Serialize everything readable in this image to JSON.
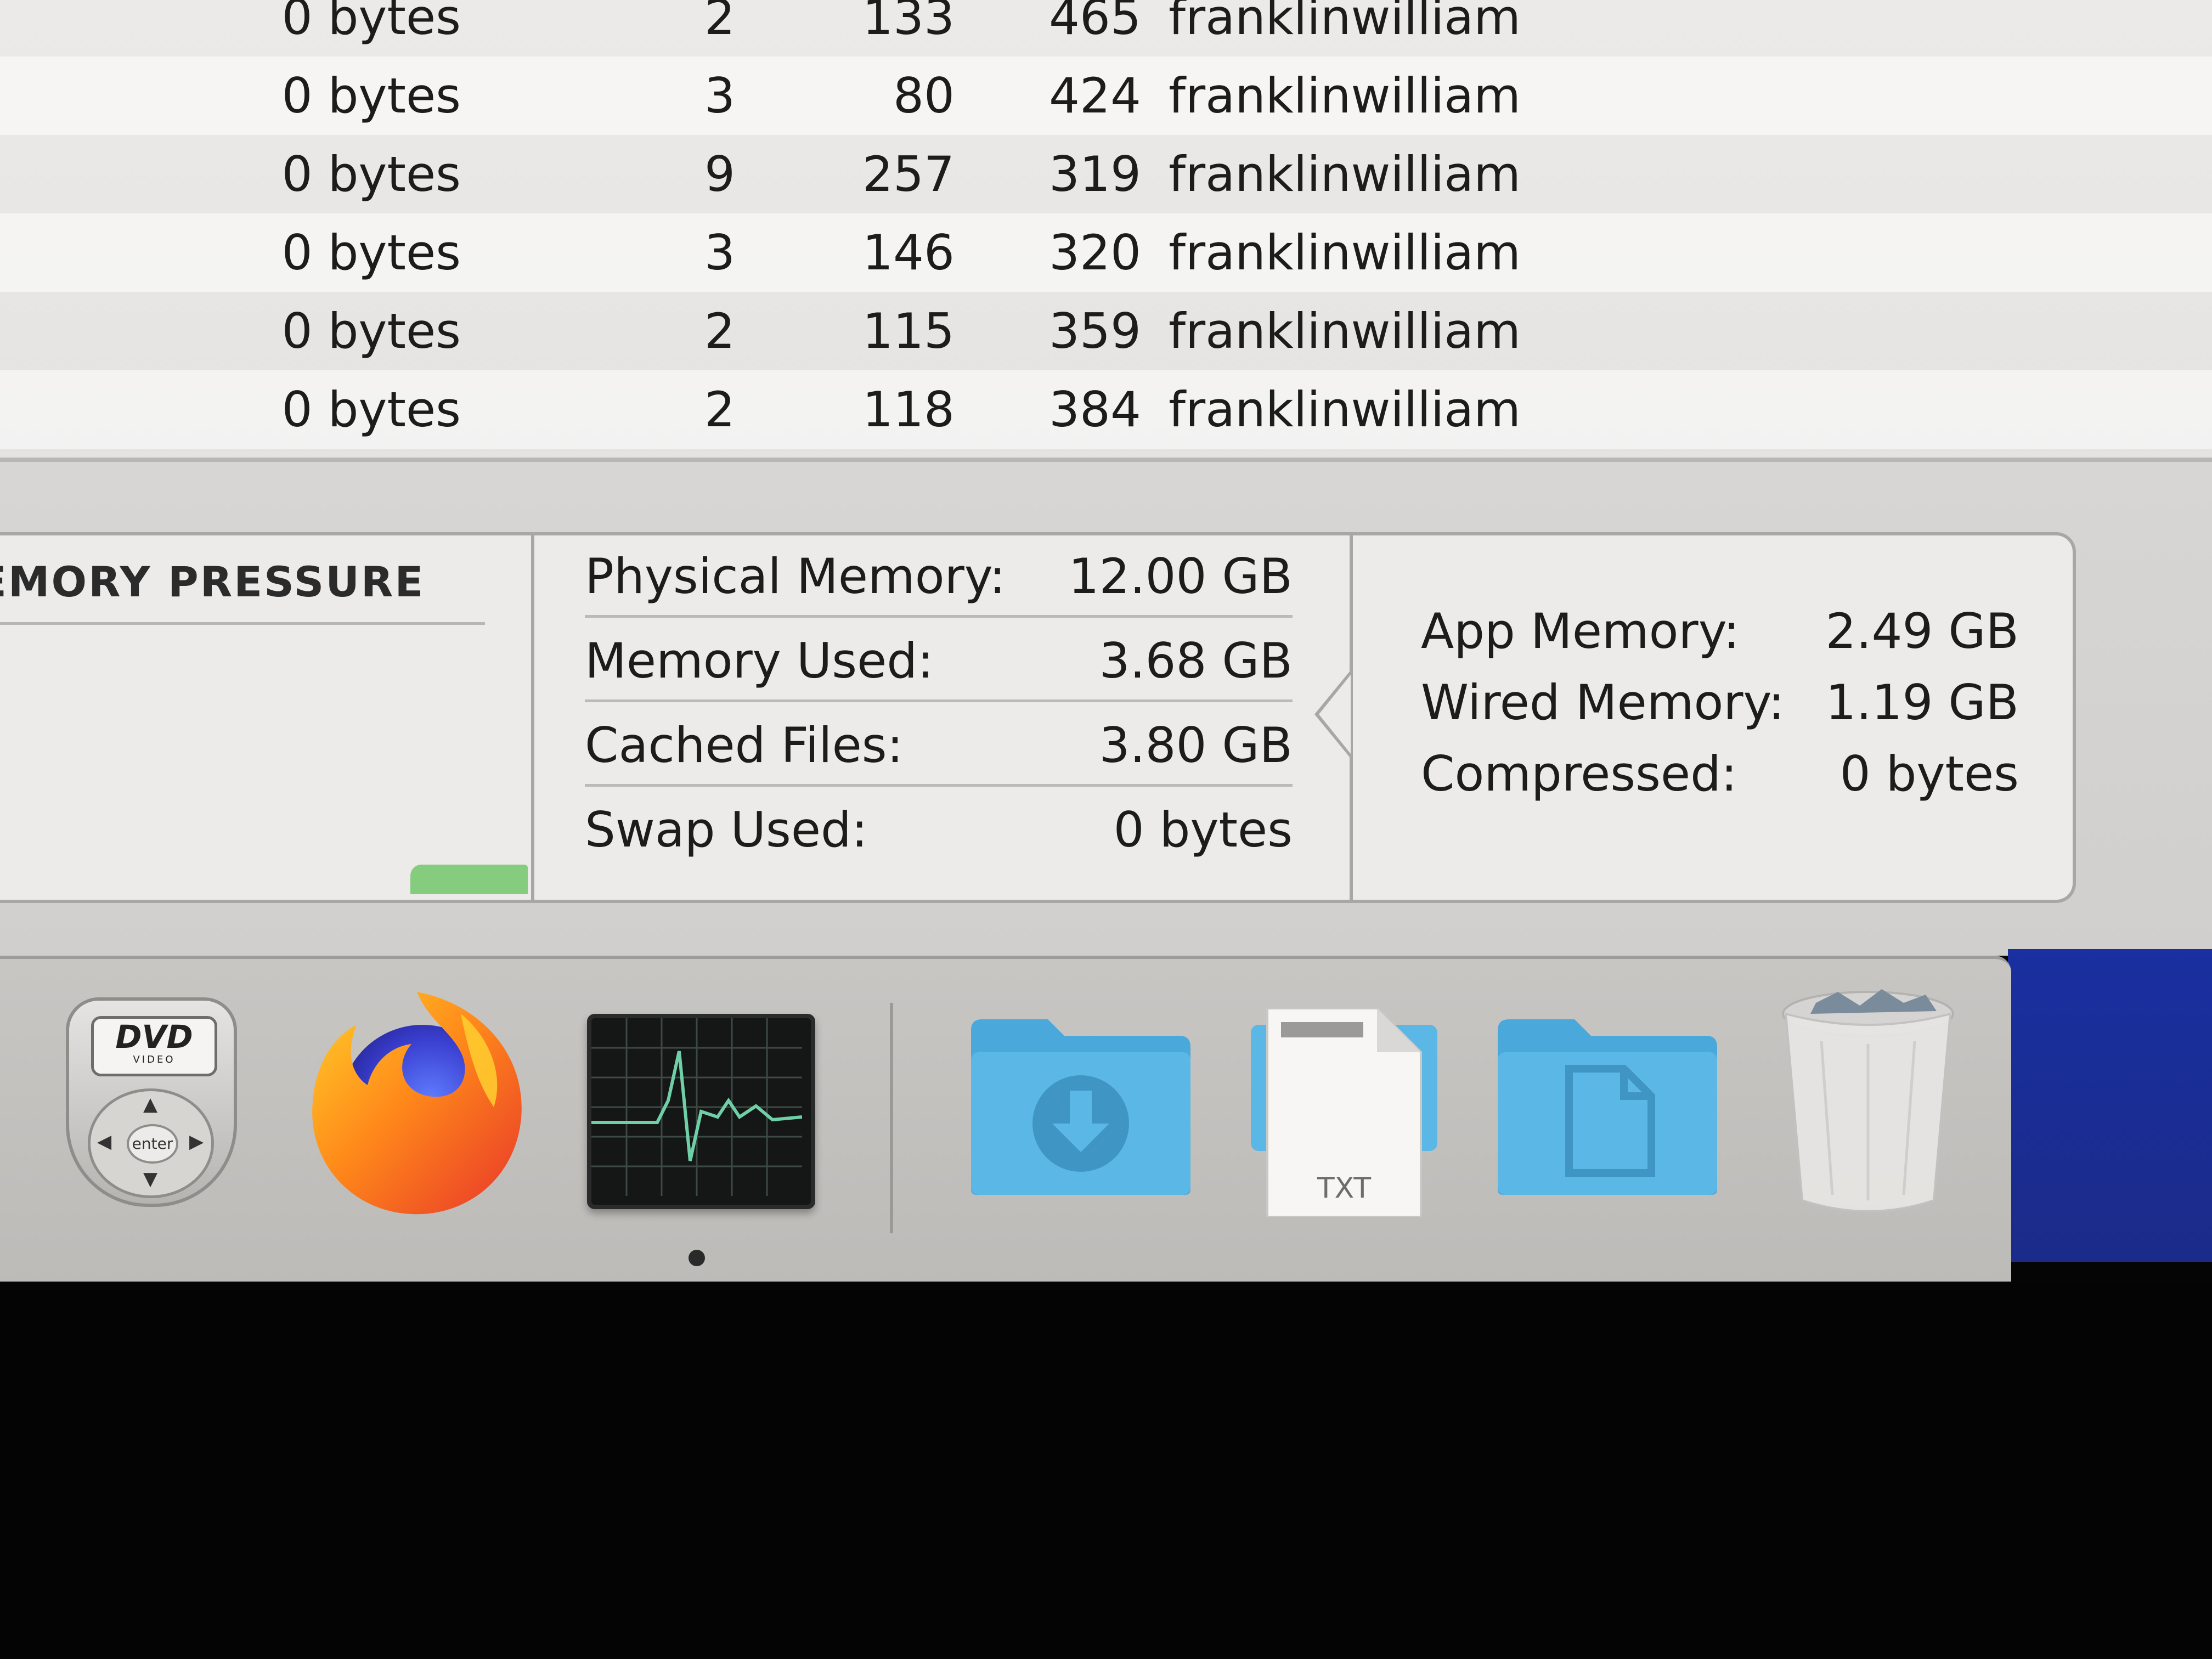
{
  "process_table": {
    "rows": [
      {
        "memory": "0 bytes",
        "threads": "2",
        "ports": "133",
        "pid": "465",
        "user": "franklinwilliams"
      },
      {
        "memory": "0 bytes",
        "threads": "3",
        "ports": "80",
        "pid": "424",
        "user": "franklinwilliams"
      },
      {
        "memory": "0 bytes",
        "threads": "9",
        "ports": "257",
        "pid": "319",
        "user": "franklinwilliams"
      },
      {
        "memory": "0 bytes",
        "threads": "3",
        "ports": "146",
        "pid": "320",
        "user": "franklinwilliams"
      },
      {
        "memory": "0 bytes",
        "threads": "2",
        "ports": "115",
        "pid": "359",
        "user": "franklinwilliams"
      },
      {
        "memory": "0 bytes",
        "threads": "2",
        "ports": "118",
        "pid": "384",
        "user": "franklinwilliams"
      }
    ]
  },
  "memory_pressure": {
    "title": "EMORY PRESSURE",
    "graph_color": "#86cc7f"
  },
  "memory_stats": [
    {
      "label": "Physical Memory:",
      "value": "12.00 GB"
    },
    {
      "label": "Memory Used:",
      "value": "3.68 GB"
    },
    {
      "label": "Cached Files:",
      "value": "3.80 GB"
    },
    {
      "label": "Swap Used:",
      "value": "0 bytes"
    }
  ],
  "memory_breakdown": [
    {
      "label": "App Memory:",
      "value": "2.49 GB"
    },
    {
      "label": "Wired Memory:",
      "value": "1.19 GB"
    },
    {
      "label": "Compressed:",
      "value": "0 bytes"
    }
  ],
  "dock": {
    "items": [
      {
        "name": "dvd-player-icon"
      },
      {
        "name": "firefox-icon"
      },
      {
        "name": "activity-monitor-icon",
        "running": true
      },
      {
        "name": "downloads-folder-icon"
      },
      {
        "name": "txt-document-icon"
      },
      {
        "name": "documents-folder-icon"
      },
      {
        "name": "trash-icon"
      }
    ],
    "dvd": {
      "logo": "DVD",
      "sub": "VIDEO",
      "enter": "enter"
    },
    "txt_label": "TXT"
  },
  "colors": {
    "folder_blue": "#5bb8e6",
    "desktop_blue": "#1b2b8a",
    "activity_line": "#6fd0a8"
  }
}
